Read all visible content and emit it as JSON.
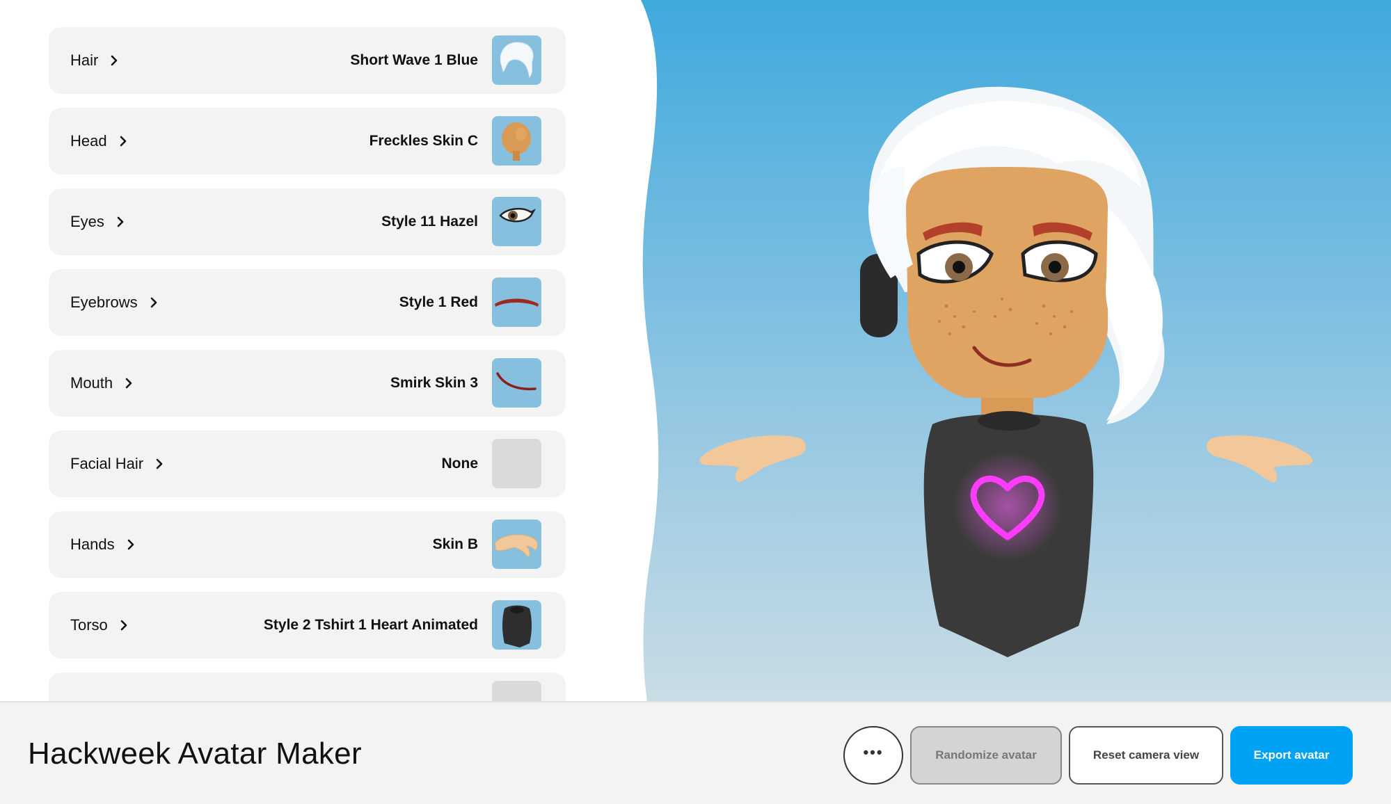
{
  "app": {
    "title": "Hackweek Avatar Maker"
  },
  "categories": [
    {
      "label": "Hair",
      "value": "Short Wave 1 Blue",
      "icon": "hair-icon"
    },
    {
      "label": "Head",
      "value": "Freckles Skin C",
      "icon": "head-icon"
    },
    {
      "label": "Eyes",
      "value": "Style 11 Hazel",
      "icon": "eye-icon"
    },
    {
      "label": "Eyebrows",
      "value": "Style 1 Red",
      "icon": "eyebrow-icon"
    },
    {
      "label": "Mouth",
      "value": "Smirk Skin 3",
      "icon": "mouth-icon"
    },
    {
      "label": "Facial Hair",
      "value": "None",
      "icon": "empty-icon"
    },
    {
      "label": "Hands",
      "value": "Skin B",
      "icon": "hand-icon"
    },
    {
      "label": "Torso",
      "value": "Style 2 Tshirt 1 Heart Animated",
      "icon": "torso-icon"
    }
  ],
  "toolbar": {
    "more_label": "•••",
    "randomize_label": "Randomize avatar",
    "reset_label": "Reset camera view",
    "export_label": "Export avatar"
  },
  "colors": {
    "accent": "#00a2f4",
    "panel_row": "#f3f3f3",
    "thumb_bg": "#87c0df",
    "sky_top": "#3fa9dd",
    "sky_bottom": "#c9dce4",
    "heart": "#ff44ff"
  }
}
